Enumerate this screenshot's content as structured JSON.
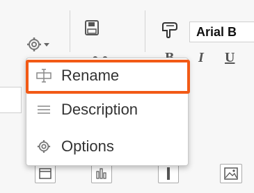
{
  "toolbar": {
    "font_name": "Arial B",
    "format_bold": "B",
    "format_italic": "I",
    "format_underline": "U"
  },
  "menu": {
    "items": [
      {
        "label": "Rename",
        "icon": "rename-icon"
      },
      {
        "label": "Description",
        "icon": "lines-icon"
      },
      {
        "label": "Options",
        "icon": "gear-icon"
      }
    ],
    "highlighted": "Rename",
    "highlight_color": "#f25a16"
  }
}
